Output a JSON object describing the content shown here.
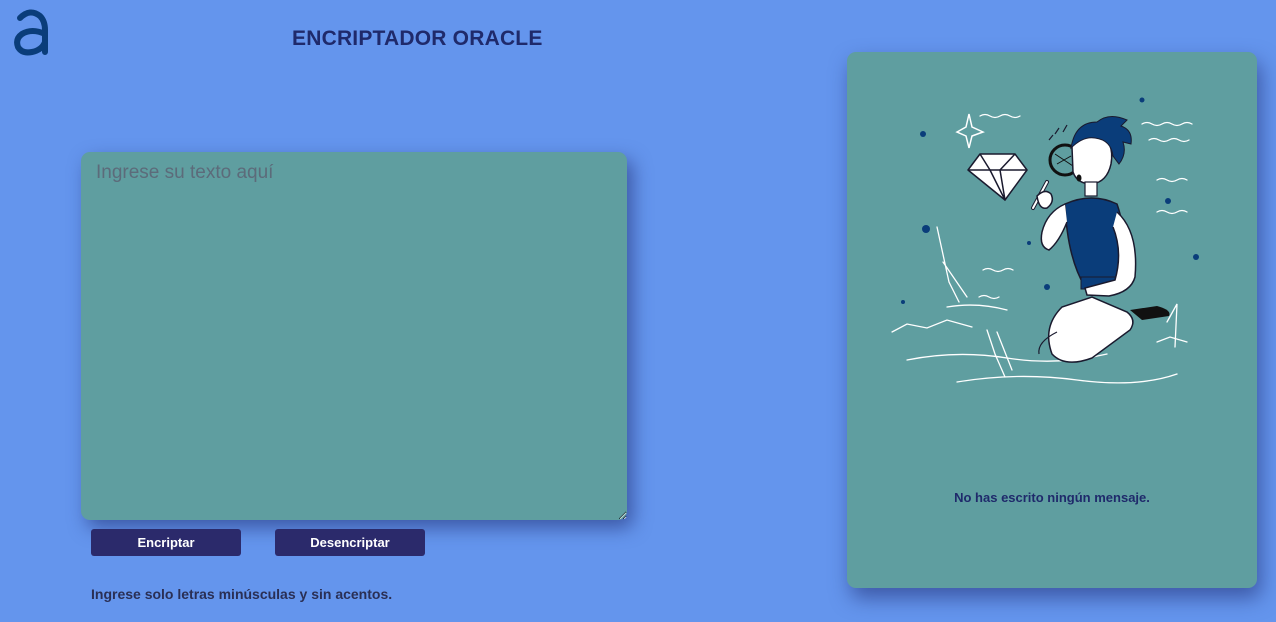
{
  "header": {
    "logo_icon": "alura-a-logo-icon",
    "title": "ENCRIPTADOR ORACLE"
  },
  "input": {
    "placeholder": "Ingrese su texto aquí",
    "value": ""
  },
  "buttons": {
    "encrypt_label": "Encriptar",
    "decrypt_label": "Desencriptar"
  },
  "hint": "Ingrese solo letras minúsculas y sin acentos.",
  "output": {
    "illustration_icon": "person-with-magnifier-diamond-illustration-icon",
    "empty_message": "No has escrito ningún mensaje."
  },
  "colors": {
    "background": "#6495ed",
    "panel": "#5f9ea0",
    "button": "#2b2a6b",
    "title_text": "#1f2a6b",
    "logo": "#0a3d7a"
  }
}
